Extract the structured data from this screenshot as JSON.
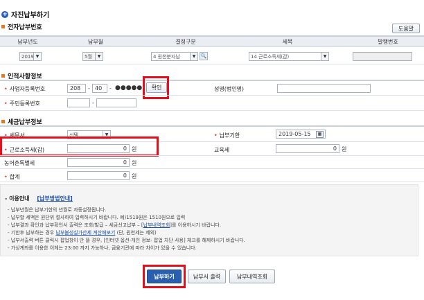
{
  "page": {
    "title": "자진납부하기"
  },
  "sections": {
    "e_number": {
      "title": "전자납부번호",
      "help_btn": "도움말",
      "headers": [
        "납부년도",
        "납부월",
        "결정구분",
        "세목",
        "발행번호"
      ],
      "year": "2019",
      "month": "5월",
      "decision": "4 원천분자납",
      "tax_item": "14 근로소득세(갑)"
    },
    "personal": {
      "title": "인적사항정보",
      "biz_label": "사업자등록번호",
      "biz1": "208",
      "biz2": "40",
      "biz_mask": "●●●●●",
      "confirm_btn": "확인",
      "name_label": "성명(법인명)",
      "rrn_label": "주민등록번호"
    },
    "tax": {
      "title": "세금납부정보",
      "office_label": "세무서",
      "office_value": "선택",
      "due_label": "납부기한",
      "due_value": "2019-05-15",
      "income_label": "근로소득세(갑)",
      "income_value": "0",
      "edu_label": "교육세",
      "edu_value": "0",
      "rural_label": "농어촌특별세",
      "rural_value": "0",
      "total_label": "합계",
      "total_value": "0",
      "unit": "원"
    }
  },
  "notice": {
    "title": "- 이용안내",
    "guide_link": "[납부방법안내]",
    "lines": [
      "- 납부년월은 납부기한의 년월로 자동설정됩니다.",
      "- 납부할 세액은 원단위 절사하여 입력하시기 바랍니다. 예)1519원은 1510원으로 입력",
      "- 납부결과 확인과 납부확인서 출력은 조회/발급 – 세금신고납부 – [",
      "- 기한후 납부하는 경우 ",
      "- 납부서출력 버튼 클릭시 팝업창이 안 뜰 경우, [인터넷 옵션-개인 정보- 팝업 차단 사용] 체크를 해제하시기 바랍니다.",
      "- 가상계좌를 이용한 이체는 23:00 까지 가능하나, 금융기관에 따라 차이가 있을 수 있습니다."
    ],
    "line3_link": "납부내역조회",
    "line3_tail": "]를 이용하시기 바랍니다.",
    "line4_link": "납부불성실가산세 계산해보기",
    "line4_tail": " (단, 원천세는 제외)"
  },
  "buttons": {
    "pay": "납부하기",
    "print": "납부서 출력",
    "history": "납부내역조회"
  }
}
